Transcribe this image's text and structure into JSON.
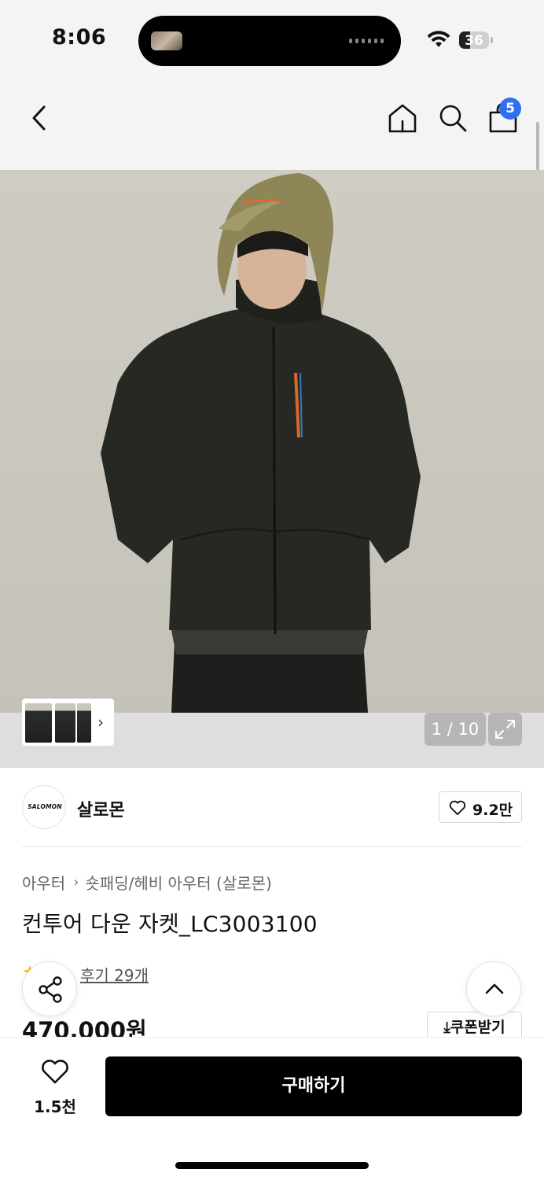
{
  "status_bar": {
    "time": "8:06",
    "battery": "36",
    "battery_level": 0.36
  },
  "nav": {
    "cart_count": "5",
    "icons": [
      "back-icon",
      "home-icon",
      "search-icon",
      "shopping-bag-icon"
    ]
  },
  "gallery": {
    "counter": "1 / 10",
    "thumbnails_count": 3
  },
  "brand": {
    "logo_text": "SALOMON",
    "name": "살로몬",
    "likes": "9.2만"
  },
  "product": {
    "breadcrumb": [
      "아우터",
      "숏패딩/헤비 아우터 (살로몬)"
    ],
    "title": "컨투어 다운 자켓_LC3003100",
    "reviews": "후기 29개",
    "price": "470,000원",
    "coupon_label": "쿠폰받기"
  },
  "bottom_bar": {
    "wish_count": "1.5천",
    "buy_label": "구매하기"
  },
  "colors": {
    "badge": "#2f6ff0",
    "buy_button": "#000000",
    "star": "#f5b400"
  }
}
